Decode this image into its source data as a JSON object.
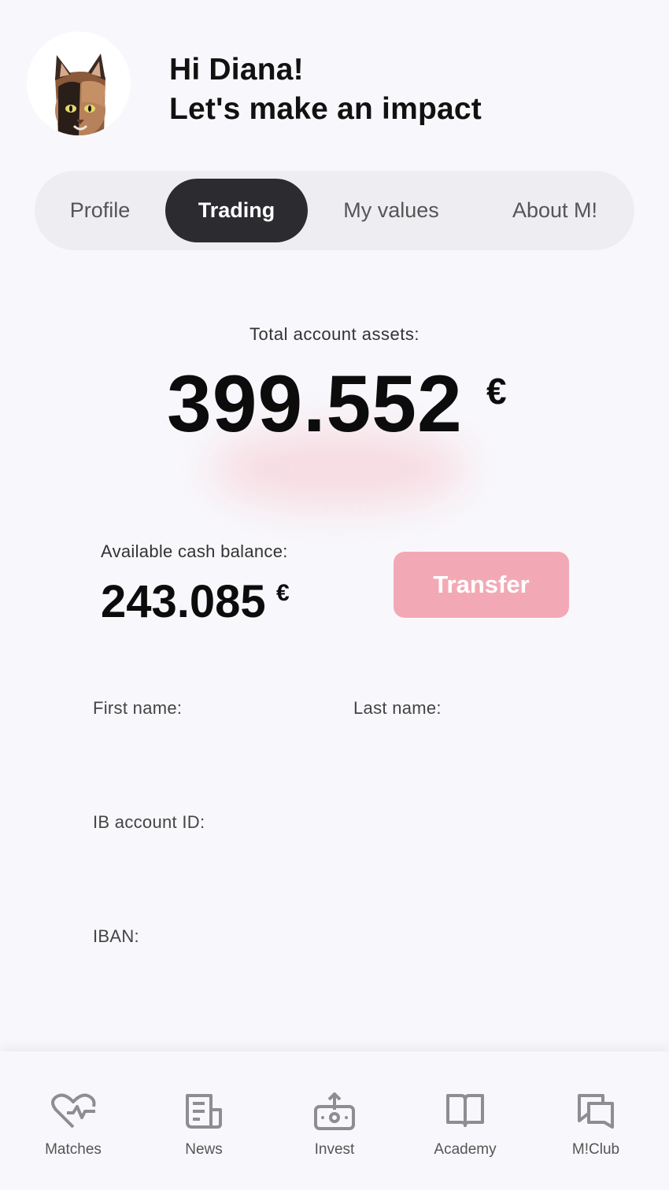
{
  "header": {
    "greeting_line1": "Hi Diana!",
    "greeting_line2": "Let's make an impact"
  },
  "tabs": [
    {
      "label": "Profile",
      "active": false
    },
    {
      "label": "Trading",
      "active": true
    },
    {
      "label": "My values",
      "active": false
    },
    {
      "label": "About M!",
      "active": false
    }
  ],
  "assets": {
    "total_label": "Total account assets:",
    "total_value": "399.552",
    "currency": "€",
    "cash_label": "Available cash balance:",
    "cash_value": "243.085",
    "transfer_label": "Transfer"
  },
  "fields": {
    "first_name_label": "First name:",
    "last_name_label": "Last name:",
    "ib_account_label": "IB account ID:",
    "iban_label": "IBAN:"
  },
  "bottom_nav": [
    {
      "label": "Matches",
      "icon": "heart-pulse-icon"
    },
    {
      "label": "News",
      "icon": "newspaper-icon"
    },
    {
      "label": "Invest",
      "icon": "invest-upload-icon"
    },
    {
      "label": "Academy",
      "icon": "book-icon"
    },
    {
      "label": "M!Club",
      "icon": "chat-bubbles-icon"
    }
  ],
  "colors": {
    "accent_pink": "#f3a9b5",
    "active_tab": "#2b2b30",
    "background": "#f8f8fc"
  }
}
